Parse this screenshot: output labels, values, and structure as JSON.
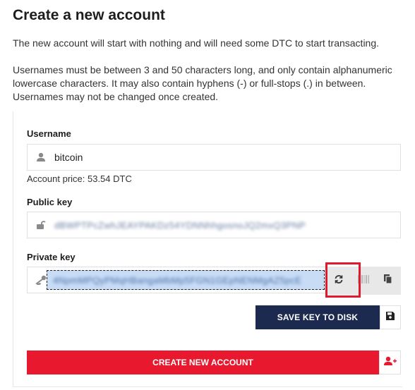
{
  "page": {
    "title": "Create a new account",
    "intro": "The new account will start with nothing and will need some DTC to start transacting.",
    "rules_line1": "Usernames must be between 3 and 50 characters long, and only contain alphanumeric",
    "rules_line2": "lowercase characters. It may also contain hyphens (-) or full-stops (.) in between.",
    "rules_line3": "Usernames may not be changed once created."
  },
  "username": {
    "label": "Username",
    "value": "bitcoin",
    "icon": "user-icon",
    "price": "Account price: 53.54 DTC"
  },
  "public_key": {
    "label": "Public key",
    "value": "dBWPTPcZwhJEAYPAKDz54YDNNhhgosnoJQ2mxQ3PNP",
    "icon": "unlock-icon"
  },
  "private_key": {
    "label": "Private key",
    "value": "4NpmMPQyPMqHBangaMbMp5FGN1GEpNENMgAZ5pcE",
    "icon": "key-icon",
    "buttons": [
      "refresh-icon",
      "barcode-icon",
      "copy-icon"
    ]
  },
  "actions": {
    "save_label": "SAVE KEY TO DISK",
    "save_icon": "save-icon",
    "create_label": "CREATE NEW ACCOUNT",
    "create_icon": "add-user-icon"
  },
  "colors": {
    "save_button": "#1c2a4f",
    "create_button": "#e8192f",
    "highlight": "#e0192f"
  }
}
